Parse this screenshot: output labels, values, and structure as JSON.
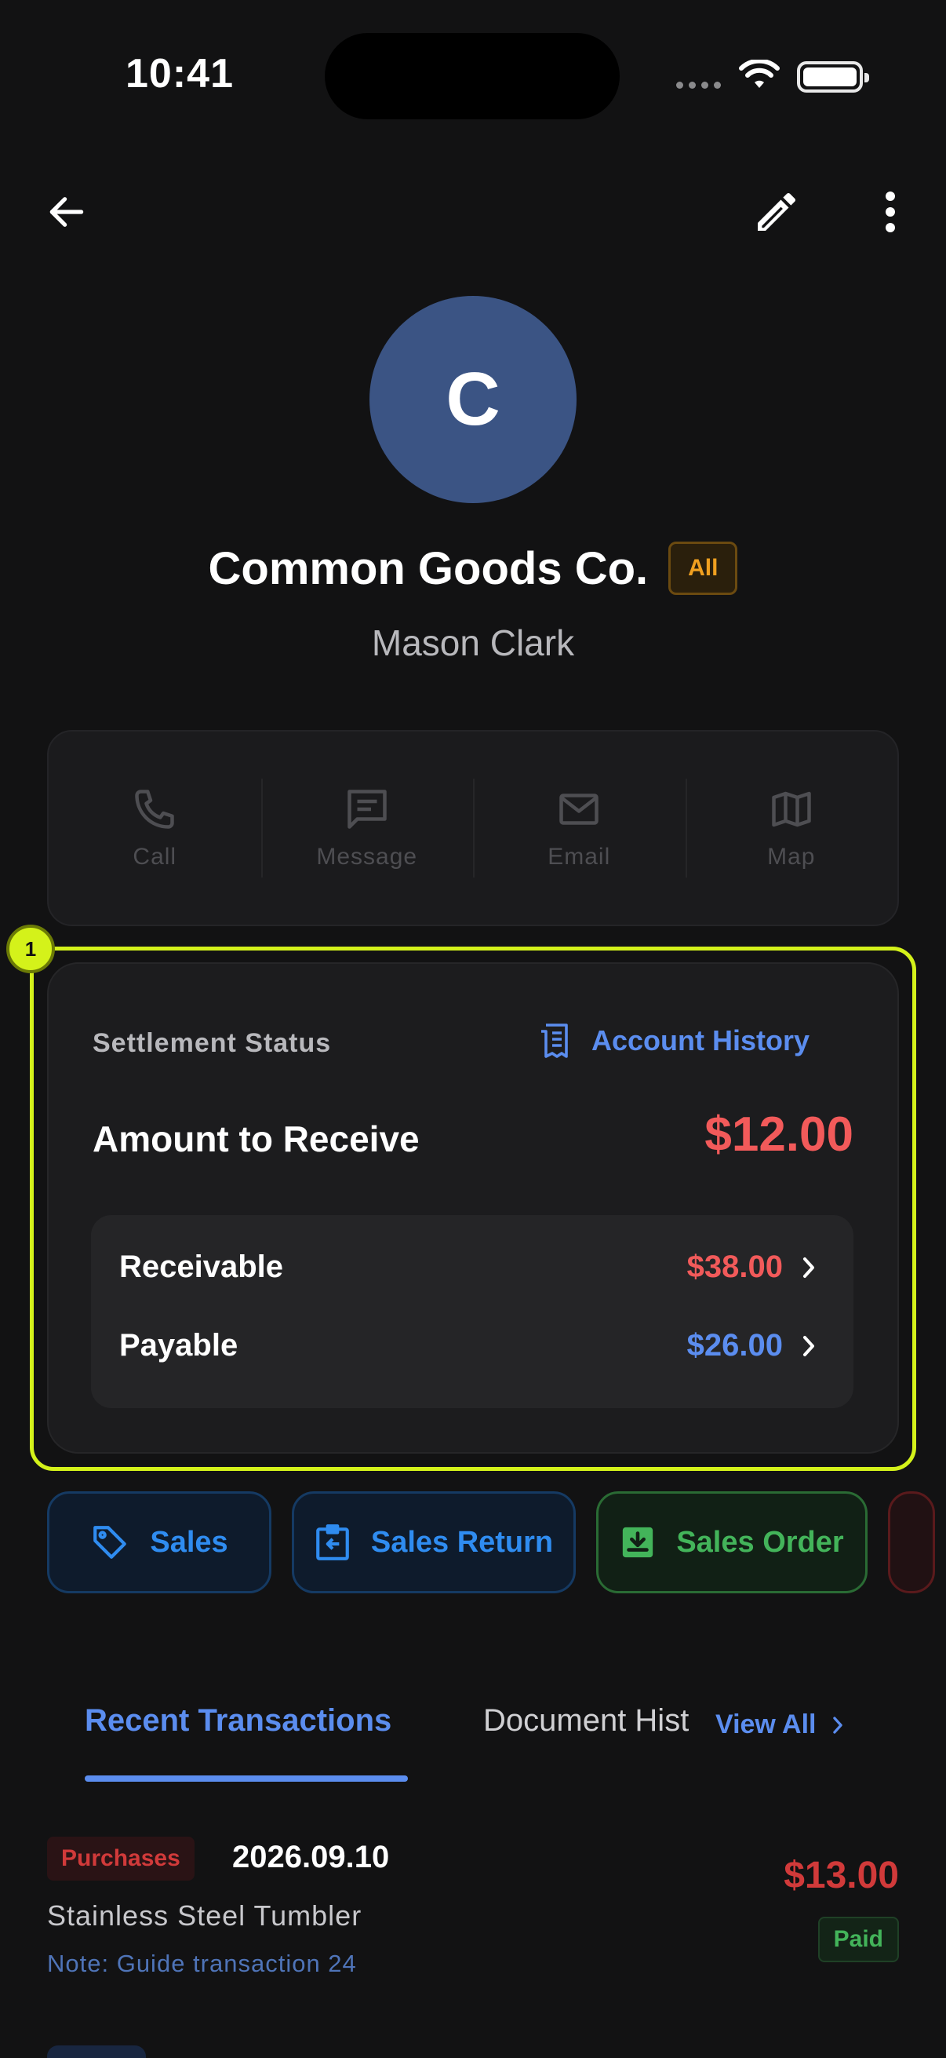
{
  "status_bar": {
    "time": "10:41"
  },
  "profile": {
    "avatar_initial": "C",
    "company_name": "Common Goods Co.",
    "tag": "All",
    "contact_name": "Mason Clark"
  },
  "contact_actions": [
    {
      "label": "Call",
      "icon": "phone-icon"
    },
    {
      "label": "Message",
      "icon": "message-icon"
    },
    {
      "label": "Email",
      "icon": "mail-icon"
    },
    {
      "label": "Map",
      "icon": "map-icon"
    }
  ],
  "settlement": {
    "highlight_number": "1",
    "title": "Settlement Status",
    "history_link": "Account History",
    "amount_label": "Amount to Receive",
    "amount_value": "$12.00",
    "receivable_label": "Receivable",
    "receivable_value": "$38.00",
    "payable_label": "Payable",
    "payable_value": "$26.00"
  },
  "document_buttons": [
    {
      "label": "Sales",
      "icon": "tag-icon"
    },
    {
      "label": "Sales Return",
      "icon": "clipboard-return-icon"
    },
    {
      "label": "Sales Order",
      "icon": "download-box-icon"
    }
  ],
  "tabs": {
    "recent": "Recent Transactions",
    "documents": "Document History",
    "view_all": "View All"
  },
  "transaction": {
    "type": "Purchases",
    "date": "2026.09.10",
    "item": "Stainless Steel Tumbler",
    "note": "Note: Guide transaction 24",
    "amount": "$13.00",
    "status": "Paid"
  },
  "colors": {
    "background": "#121213",
    "accent_blue": "#5b8def",
    "negative_red": "#f25a5a",
    "positive_green": "#43b45a",
    "highlight": "#d4f21a"
  }
}
